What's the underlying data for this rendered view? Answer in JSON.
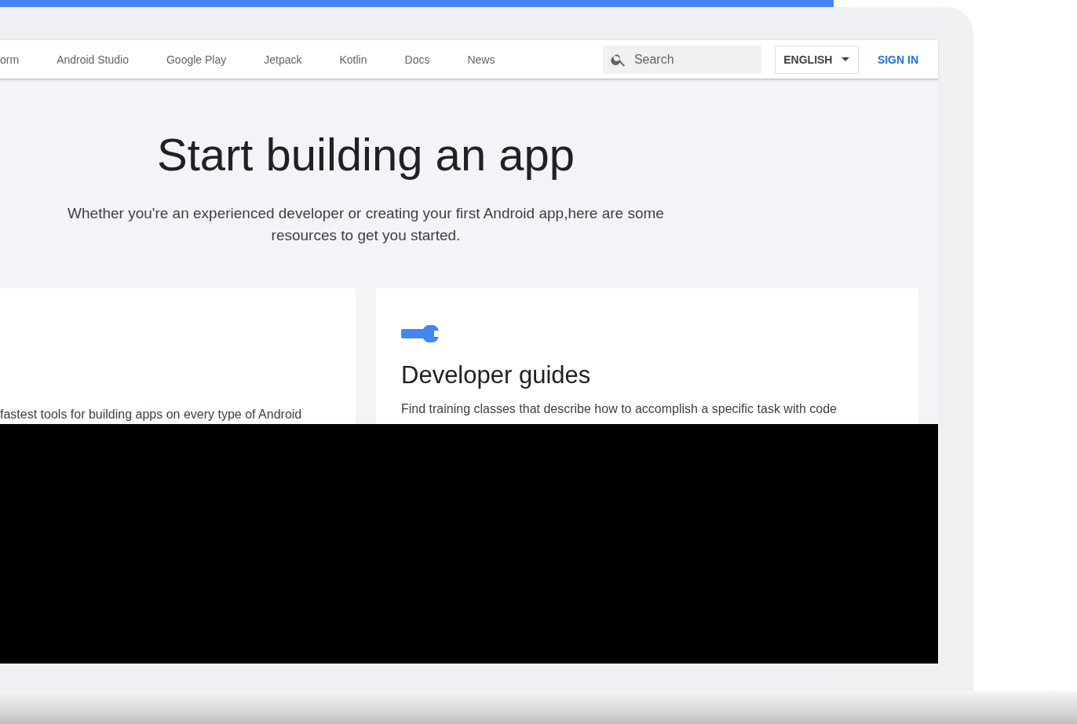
{
  "nav": {
    "links": [
      {
        "label": "orm"
      },
      {
        "label": "Android Studio"
      },
      {
        "label": "Google Play"
      },
      {
        "label": "Jetpack"
      },
      {
        "label": "Kotlin"
      },
      {
        "label": "Docs"
      },
      {
        "label": "News"
      }
    ],
    "search": {
      "placeholder": "Search"
    },
    "language": {
      "label": "ENGLISH"
    },
    "sign_in": "SIGN IN"
  },
  "hero": {
    "title": "Start building an app",
    "subtitle": "Whether you're an experienced developer or creating your first Android app,here are some resources to get you started."
  },
  "cards": [
    {
      "kind": "text",
      "text": "fastest tools for building apps on every type of Android"
    },
    {
      "kind": "guide",
      "title": "Developer guides",
      "text": "Find training classes that describe how to accomplish a specific task with code"
    }
  ]
}
